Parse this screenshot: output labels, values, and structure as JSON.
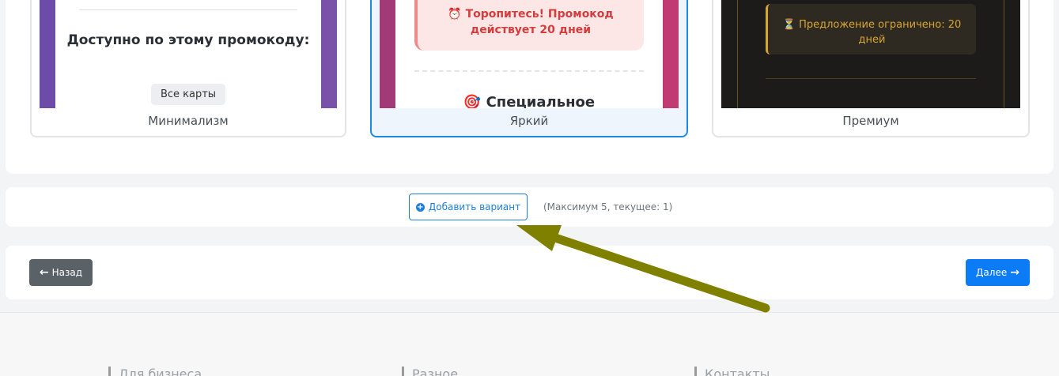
{
  "templates": [
    {
      "caption": "Минимализм",
      "preview_heading": "Доступно по этому промокоду:",
      "preview_chip": "Все карты"
    },
    {
      "caption": "Яркий",
      "preview_alert_icon": "⏰",
      "preview_alert": "Торопитесь! Промокод действует 20 дней",
      "preview_heading_icon": "🎯",
      "preview_heading": "Специальное",
      "selected": true
    },
    {
      "caption": "Премиум",
      "preview_offer_icon": "⏳",
      "preview_offer": "Предложение ограничено: 20 дней"
    }
  ],
  "add_variant": {
    "label": "Добавить вариант",
    "icon": "plus-circle-icon",
    "hint": "(Максимум 5, текущее: 1)"
  },
  "nav": {
    "back_label": "Назад",
    "next_label": "Далее"
  },
  "footer": {
    "col1": "Для бизнеса",
    "col2": "Разное",
    "col3": "Контакты"
  },
  "colors": {
    "accent": "#1e7fd8",
    "next_button": "#0b7cf5",
    "back_button": "#5a6268",
    "annotation_arrow": "#808000"
  }
}
